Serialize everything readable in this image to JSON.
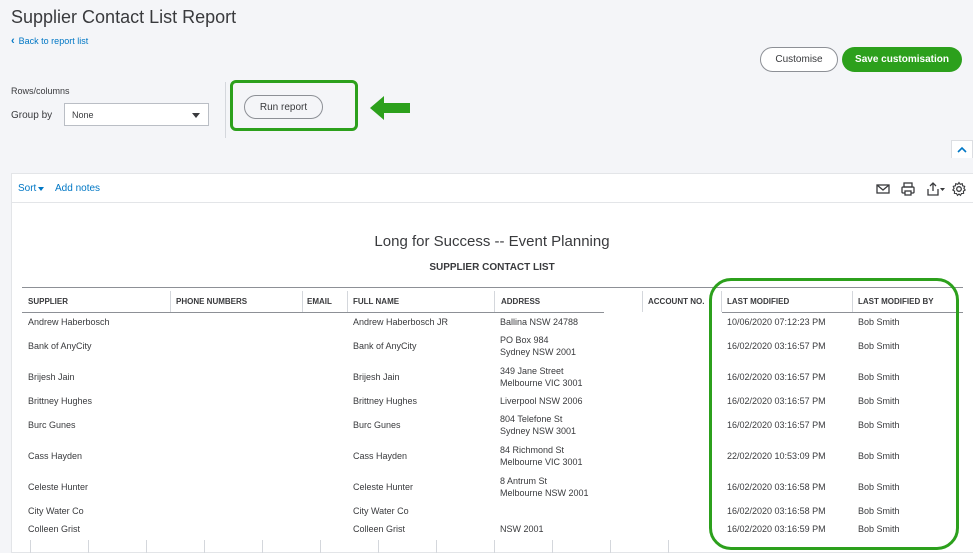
{
  "page": {
    "title": "Supplier Contact List Report",
    "back_label": "Back to report list"
  },
  "header_buttons": {
    "customise": "Customise",
    "save": "Save customisation"
  },
  "controls": {
    "rows_columns_label": "Rows/columns",
    "group_by_label": "Group by",
    "group_by_value": "None",
    "run_report": "Run report"
  },
  "toolbar": {
    "sort_label": "Sort",
    "add_notes": "Add notes",
    "icons": [
      "mail-icon",
      "print-icon",
      "export-icon",
      "settings-icon"
    ]
  },
  "report": {
    "company": "Long for Success -- Event Planning",
    "heading": "SUPPLIER CONTACT LIST",
    "columns": [
      "SUPPLIER",
      "PHONE NUMBERS",
      "EMAIL",
      "FULL NAME",
      "ADDRESS",
      "ACCOUNT NO.",
      "LAST MODIFIED",
      "LAST MODIFIED BY"
    ],
    "rows": [
      {
        "supplier": "Andrew Haberbosch",
        "full_name": "Andrew Haberbosch JR",
        "address1": "Ballina NSW 24788",
        "address2": "",
        "last_modified": "10/06/2020 07:12:23 PM",
        "modified_by": "Bob Smith"
      },
      {
        "supplier": "Bank of AnyCity",
        "full_name": "Bank of AnyCity",
        "address1": "PO Box 984",
        "address2": "Sydney NSW 2001",
        "last_modified": "16/02/2020 03:16:57 PM",
        "modified_by": "Bob Smith"
      },
      {
        "supplier": "Brijesh Jain",
        "full_name": "Brijesh Jain",
        "address1": "349 Jane Street",
        "address2": "Melbourne VIC 3001",
        "last_modified": "16/02/2020 03:16:57 PM",
        "modified_by": "Bob Smith"
      },
      {
        "supplier": "Brittney Hughes",
        "full_name": "Brittney Hughes",
        "address1": "Liverpool NSW 2006",
        "address2": "",
        "last_modified": "16/02/2020 03:16:57 PM",
        "modified_by": "Bob Smith"
      },
      {
        "supplier": "Burc Gunes",
        "full_name": "Burc Gunes",
        "address1": "804 Telefone St",
        "address2": "Sydney NSW 3001",
        "last_modified": "16/02/2020 03:16:57 PM",
        "modified_by": "Bob Smith"
      },
      {
        "supplier": "Cass Hayden",
        "full_name": "Cass Hayden",
        "address1": "84 Richmond St",
        "address2": "Melbourne VIC 3001",
        "last_modified": "22/02/2020 10:53:09 PM",
        "modified_by": "Bob Smith"
      },
      {
        "supplier": "Celeste Hunter",
        "full_name": "Celeste Hunter",
        "address1": "8 Antrum St",
        "address2": "Melbourne NSW 2001",
        "last_modified": "16/02/2020 03:16:58 PM",
        "modified_by": "Bob Smith"
      },
      {
        "supplier": "City Water Co",
        "full_name": "City Water Co",
        "address1": "",
        "address2": "",
        "last_modified": "16/02/2020 03:16:58 PM",
        "modified_by": "Bob Smith"
      },
      {
        "supplier": "Colleen Grist",
        "full_name": "Colleen Grist",
        "address1": "NSW 2001",
        "address2": "",
        "last_modified": "16/02/2020 03:16:59 PM",
        "modified_by": "Bob Smith"
      }
    ]
  },
  "colors": {
    "accent_green": "#2ca01c",
    "link_blue": "#0077c5",
    "text": "#393a3d"
  }
}
